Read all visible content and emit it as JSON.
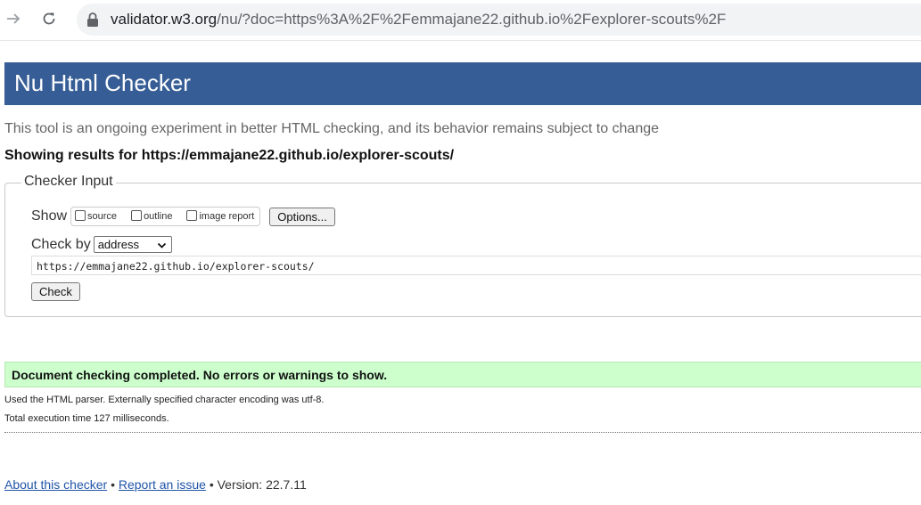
{
  "browser": {
    "url_host": "validator.w3.org",
    "url_rest": "/nu/?doc=https%3A%2F%2Femmajane22.github.io%2Fexplorer-scouts%2F",
    "icons": [
      "forward-arrow-icon",
      "reload-icon",
      "lock-icon"
    ]
  },
  "header": {
    "title": "Nu Html Checker"
  },
  "subtitle": "This tool is an ongoing experiment in better HTML checking, and its behavior remains subject to change",
  "showing_results": "Showing results for https://emmajane22.github.io/explorer-scouts/",
  "checker_input": {
    "legend": "Checker Input",
    "show_label": "Show",
    "options": [
      {
        "label": "source",
        "checked": false
      },
      {
        "label": "outline",
        "checked": false
      },
      {
        "label": "image report",
        "checked": false
      }
    ],
    "options_button": "Options...",
    "check_by_label": "Check by",
    "check_by_value": "address",
    "url_value": "https://emmajane22.github.io/explorer-scouts/",
    "check_button": "Check"
  },
  "result": {
    "message": "Document checking completed. No errors or warnings to show.",
    "color": "#ccffcc"
  },
  "info": {
    "parser": "Used the HTML parser. Externally specified character encoding was utf-8.",
    "time": "Total execution time 127 milliseconds."
  },
  "footer": {
    "about_link": "About this checker",
    "separator": "•",
    "report_link": "Report an issue",
    "version": "• Version: 22.7.11"
  },
  "colors": {
    "header_bg": "#365d95",
    "link": "#2054a8"
  }
}
